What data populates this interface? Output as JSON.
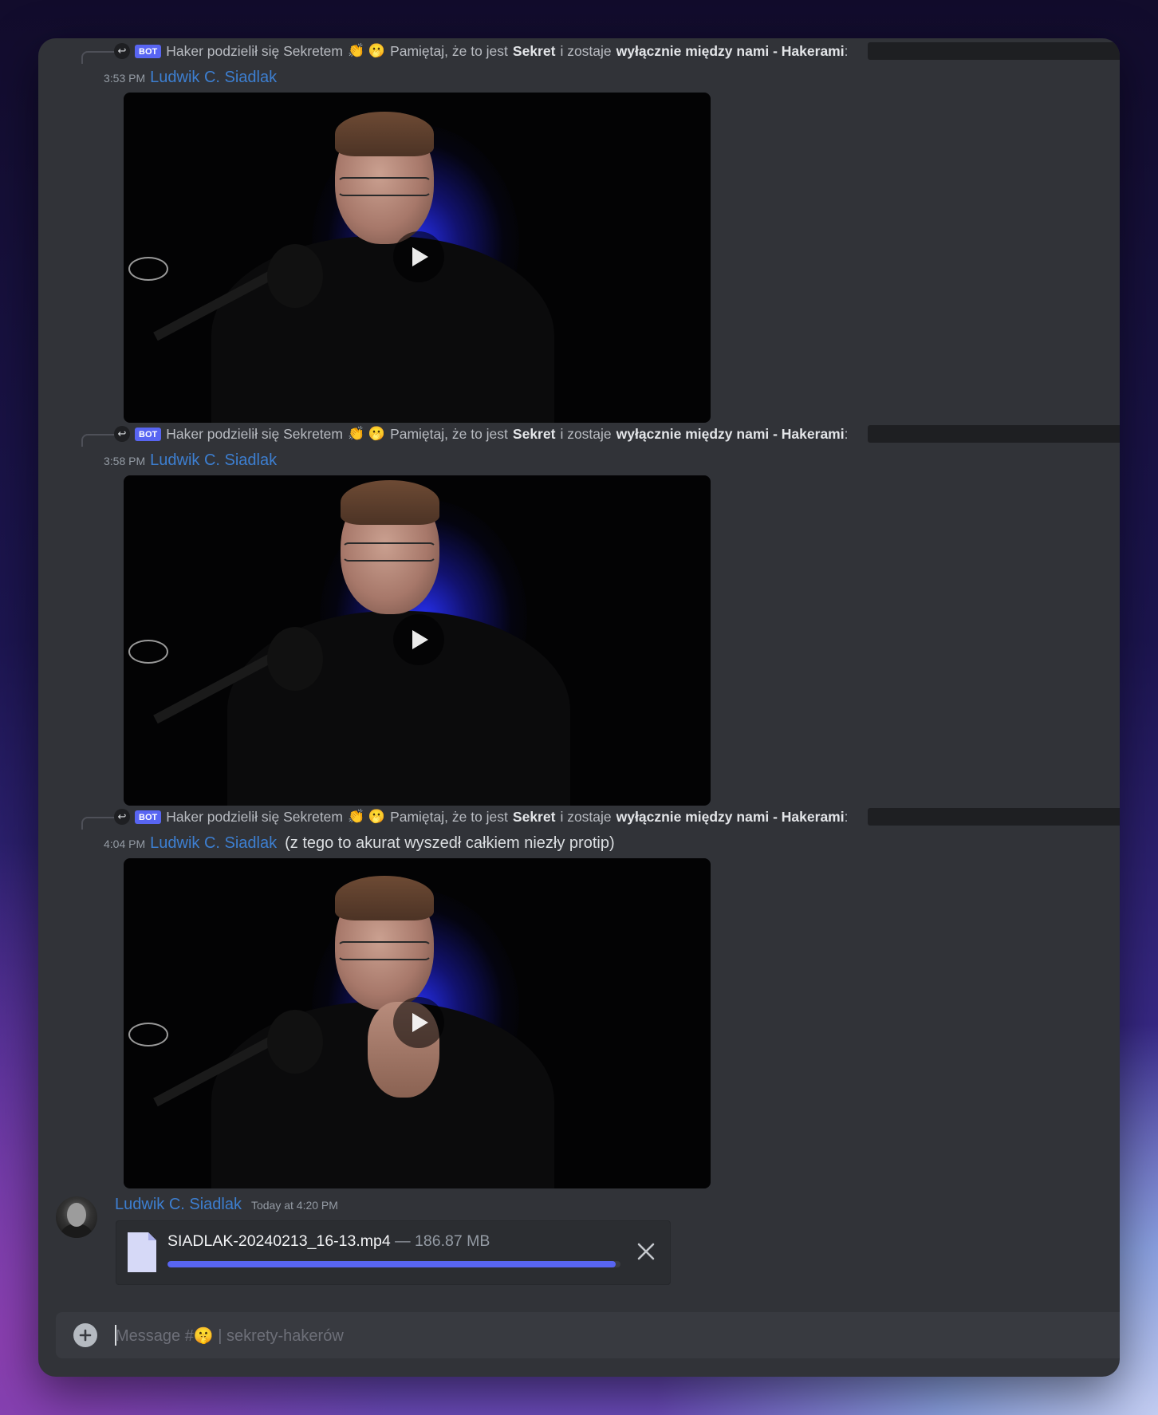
{
  "channel": {
    "placeholder_prefix": "Message #",
    "placeholder_emoji": "🤫",
    "placeholder_suffix": " | sekrety-hakerów"
  },
  "reply_preview": {
    "bot_tag": "BOT",
    "lead": "Haker podzielił się Sekretem",
    "emojis": "👏 🫢",
    "mid": "Pamiętaj, że to jest",
    "bold1": "Sekret",
    "mid2": "i zostaje",
    "bold2": "wyłącznie między nami - Hakerami",
    "tail": ":"
  },
  "messages": [
    {
      "time": "3:53 PM",
      "author": "Ludwik C. Siadlak",
      "text": ""
    },
    {
      "time": "3:58 PM",
      "author": "Ludwik C. Siadlak",
      "text": ""
    },
    {
      "time": "4:04 PM",
      "author": "Ludwik C. Siadlak",
      "text": "(z tego to akurat wyszedł całkiem niezły protip)"
    }
  ],
  "upload": {
    "author": "Ludwik C. Siadlak",
    "timestamp": "Today at 4:20 PM",
    "file_name": "SIADLAK-20240213_16-13.mp4",
    "file_size": " — 186.87 MB",
    "progress": 0.99
  },
  "colors": {
    "accent": "#5865f2",
    "author": "#3d7fd1",
    "background": "#313338"
  }
}
